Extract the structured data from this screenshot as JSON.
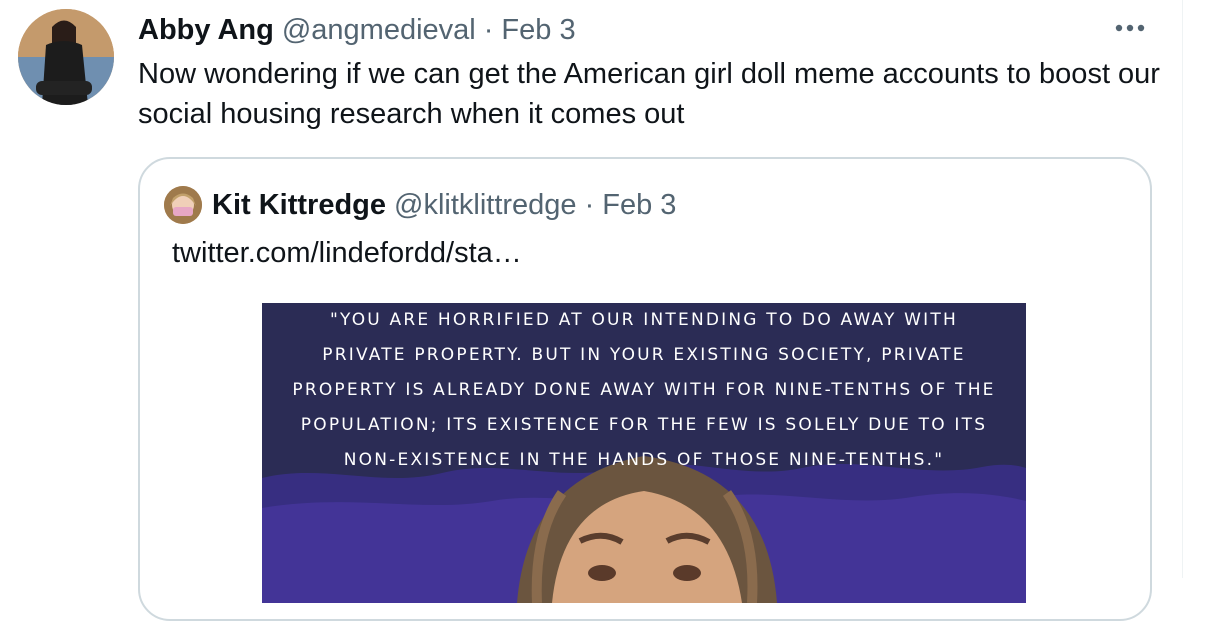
{
  "tweet": {
    "author_name": "Abby Ang",
    "author_handle": "@angmedieval",
    "separator": "·",
    "date": "Feb 3",
    "more_label": "•••",
    "text": "Now wondering if we can get the American girl doll meme accounts to boost our social housing research when it comes out"
  },
  "quoted_tweet": {
    "author_name": "Kit Kittredge",
    "author_handle": "@klitklittredge",
    "separator": "·",
    "date": "Feb 3",
    "text": "twitter.com/lindefordd/sta…",
    "image_quote_lines": [
      "\"You are horrified at our intending to do away with",
      "private property. But in your existing society, private",
      "property is already done away with for nine-tenths of the",
      "population; its existence for the few is solely due to its",
      "non-existence in the hands of those nine-tenths.\""
    ]
  },
  "colors": {
    "text_primary": "#0f1419",
    "text_secondary": "#536471",
    "border": "#cfd9de",
    "image_background": "#2b2c55"
  },
  "icons": {
    "more": "more-horizontal-icon"
  }
}
